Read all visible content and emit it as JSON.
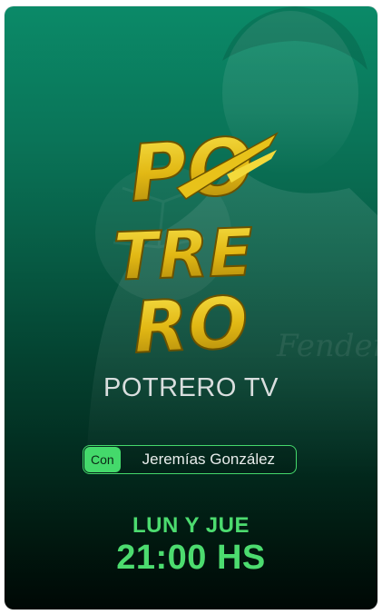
{
  "card": {
    "logo_lines": [
      "PO",
      "TRE",
      "RO"
    ],
    "show_title": "POTRERO TV",
    "host": {
      "prefix": "Con",
      "name": "Jeremías González"
    },
    "schedule": {
      "days": "LUN Y JUE",
      "time": "21:00 HS"
    },
    "colors": {
      "accent": "#44d96b",
      "gradient_top": "#0b8a68",
      "gradient_bottom": "#000805",
      "logo_gold": "#e8c21a"
    }
  }
}
